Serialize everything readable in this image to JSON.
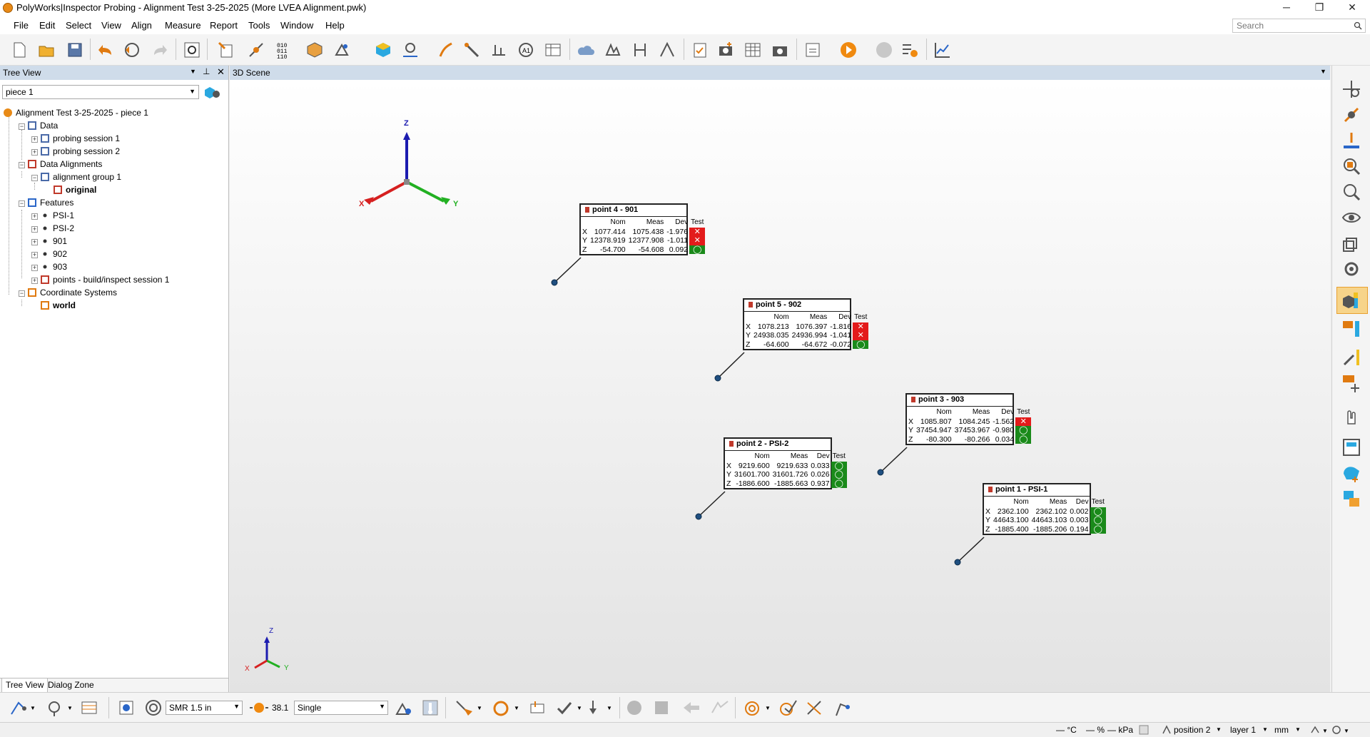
{
  "window": {
    "title": "PolyWorks|Inspector Probing - Alignment Test 3-25-2025 (More LVEA Alignment.pwk)",
    "minimize": "─",
    "maximize": "❐",
    "close": "✕"
  },
  "menu": [
    "File",
    "Edit",
    "Select",
    "View",
    "Align",
    "Measure",
    "Report",
    "Tools",
    "Window",
    "Help"
  ],
  "search": {
    "placeholder": "Search"
  },
  "tree_panel": {
    "title": "Tree View",
    "piece_selector": "piece 1",
    "tabs": [
      "Tree View",
      "Dialog Zone"
    ],
    "items": [
      {
        "label": "Alignment Test 3-25-2025 - piece 1",
        "icon": "project-icon",
        "bold": false
      },
      {
        "label": "Data",
        "icon": "data-tree-icon",
        "bold": false
      },
      {
        "label": "probing session 1",
        "icon": "data-tree-icon",
        "bold": false
      },
      {
        "label": "probing session 2",
        "icon": "data-tree-icon",
        "bold": false
      },
      {
        "label": "Data Alignments",
        "icon": "alignment-icon",
        "bold": false
      },
      {
        "label": "alignment group 1",
        "icon": "alignment-group-icon",
        "bold": false
      },
      {
        "label": "original",
        "icon": "alignment-icon",
        "bold": true
      },
      {
        "label": "Features",
        "icon": "features-icon",
        "bold": false
      },
      {
        "label": "PSI-1",
        "icon": "point-icon",
        "bold": false
      },
      {
        "label": "PSI-2",
        "icon": "point-icon",
        "bold": false
      },
      {
        "label": "901",
        "icon": "point-icon",
        "bold": false
      },
      {
        "label": "902",
        "icon": "point-icon",
        "bold": false
      },
      {
        "label": "903",
        "icon": "point-icon",
        "bold": false
      },
      {
        "label": "points - build/inspect session 1",
        "icon": "points-icon",
        "bold": false
      },
      {
        "label": "Coordinate Systems",
        "icon": "coordinate-system-icon",
        "bold": false
      },
      {
        "label": "world",
        "icon": "coordinate-system-icon",
        "bold": true
      }
    ]
  },
  "scene": {
    "title": "3D Scene",
    "axes": {
      "x": "X",
      "y": "Y",
      "z": "Z"
    },
    "colors": {
      "pass": "#1a8a1a",
      "fail": "#e31b1b",
      "x_axis": "#d62020",
      "y_axis": "#22b022",
      "z_axis": "#1c1cb0"
    },
    "columns": [
      "Nom",
      "Meas",
      "Dev",
      "Test"
    ],
    "annotations": [
      {
        "title": "point 4 - 901",
        "rows": [
          {
            "axis": "X",
            "nom": "1077.414",
            "meas": "1075.438",
            "dev": "-1.976",
            "pass": false
          },
          {
            "axis": "Y",
            "nom": "12378.919",
            "meas": "12377.908",
            "dev": "-1.011",
            "pass": false
          },
          {
            "axis": "Z",
            "nom": "-54.700",
            "meas": "-54.608",
            "dev": "0.092",
            "pass": true
          }
        ]
      },
      {
        "title": "point 5 - 902",
        "rows": [
          {
            "axis": "X",
            "nom": "1078.213",
            "meas": "1076.397",
            "dev": "-1.816",
            "pass": false
          },
          {
            "axis": "Y",
            "nom": "24938.035",
            "meas": "24936.994",
            "dev": "-1.041",
            "pass": false
          },
          {
            "axis": "Z",
            "nom": "-64.600",
            "meas": "-64.672",
            "dev": "-0.072",
            "pass": true
          }
        ]
      },
      {
        "title": "point 3 - 903",
        "rows": [
          {
            "axis": "X",
            "nom": "1085.807",
            "meas": "1084.245",
            "dev": "-1.562",
            "pass": false
          },
          {
            "axis": "Y",
            "nom": "37454.947",
            "meas": "37453.967",
            "dev": "-0.980",
            "pass": true
          },
          {
            "axis": "Z",
            "nom": "-80.300",
            "meas": "-80.266",
            "dev": "0.034",
            "pass": true
          }
        ]
      },
      {
        "title": "point 2 - PSI-2",
        "rows": [
          {
            "axis": "X",
            "nom": "9219.600",
            "meas": "9219.633",
            "dev": "0.033",
            "pass": true
          },
          {
            "axis": "Y",
            "nom": "31601.700",
            "meas": "31601.726",
            "dev": "0.026",
            "pass": true
          },
          {
            "axis": "Z",
            "nom": "-1886.600",
            "meas": "-1885.663",
            "dev": "0.937",
            "pass": true
          }
        ]
      },
      {
        "title": "point 1 - PSI-1",
        "rows": [
          {
            "axis": "X",
            "nom": "2362.100",
            "meas": "2362.102",
            "dev": "0.002",
            "pass": true
          },
          {
            "axis": "Y",
            "nom": "44643.100",
            "meas": "44643.103",
            "dev": "0.003",
            "pass": true
          },
          {
            "axis": "Z",
            "nom": "-1885.400",
            "meas": "-1885.206",
            "dev": "0.194",
            "pass": true
          }
        ]
      }
    ]
  },
  "bottom_toolbar": {
    "probe": "SMR 1.5 in",
    "value": "38.1",
    "mode": "Single"
  },
  "status": {
    "temperature": "— °C",
    "humidity": "— %",
    "pressure": "— kPa",
    "position": "position 2",
    "layer": "layer 1",
    "units": "mm"
  }
}
